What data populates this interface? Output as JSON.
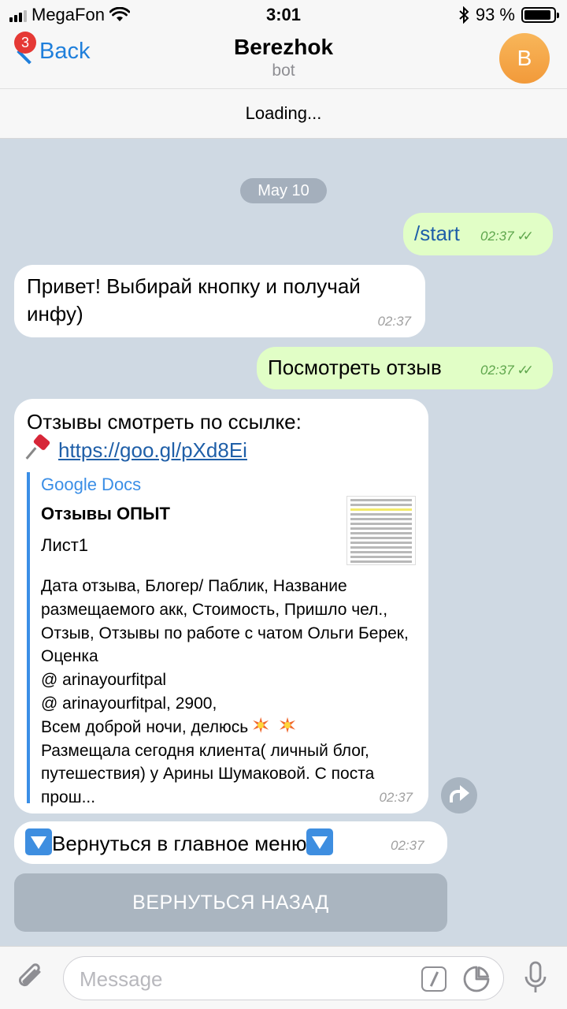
{
  "status_bar": {
    "carrier": "MegaFon",
    "time": "3:01",
    "battery": "93 %",
    "battery_level": 0.93
  },
  "nav": {
    "back_label": "Back",
    "unread_count": "3",
    "title": "Berezhok",
    "subtitle": "bot",
    "avatar_letter": "B"
  },
  "loading": "Loading...",
  "chat": {
    "date": "May 10",
    "messages": [
      {
        "direction": "out",
        "text": "/start",
        "time": "02:37"
      },
      {
        "direction": "in",
        "text": "Привет! Выбирай кнопку и получай инфу)",
        "time": "02:37"
      },
      {
        "direction": "out",
        "text": "Посмотреть отзыв",
        "time": "02:37"
      },
      {
        "direction": "in",
        "text": "Отзывы смотреть по ссылке:",
        "link": "https://goo.gl/pXd8Ei",
        "preview": {
          "site": "Google Docs",
          "title": "Отзывы ОПЫТ",
          "subtitle": "Лист1",
          "body": " Дата отзыва, Блогер/ Паблик, Название размещаемого акк, Стоимость, Пришло чел., Отзыв, Отзывы по работе с чатом Ольги Берек, Оценка",
          "body_line2": "@ arinayourfitpal",
          "body_line3": "@ arinayourfitpal, 2900,",
          "body_line4": " Всем доброй ночи, делюсь",
          "body_line5": "Размещала сегодня клиента( личный блог, путешествия) у Арины Шумаковой. С поста прош..."
        },
        "time": "02:37"
      },
      {
        "direction": "in",
        "text": "Вернуться в главное меню",
        "time": "02:37"
      }
    ]
  },
  "keyboard": {
    "button_label": "ВЕРНУТЬСЯ НАЗАД"
  },
  "input": {
    "placeholder": "Message",
    "value": ""
  },
  "colors": {
    "accent": "#1f7fdb",
    "outgoing_bubble": "#e1fec6",
    "incoming_bubble": "#ffffff",
    "chat_background": "#cfd9e3"
  },
  "icons": [
    "signal-icon",
    "wifi-icon",
    "bluetooth-icon",
    "battery-icon",
    "back-chevron-icon",
    "pin-icon",
    "share-icon",
    "attach-icon",
    "command-icon",
    "sticker-icon",
    "microphone-icon",
    "down-arrow-icon",
    "collision-icon"
  ]
}
